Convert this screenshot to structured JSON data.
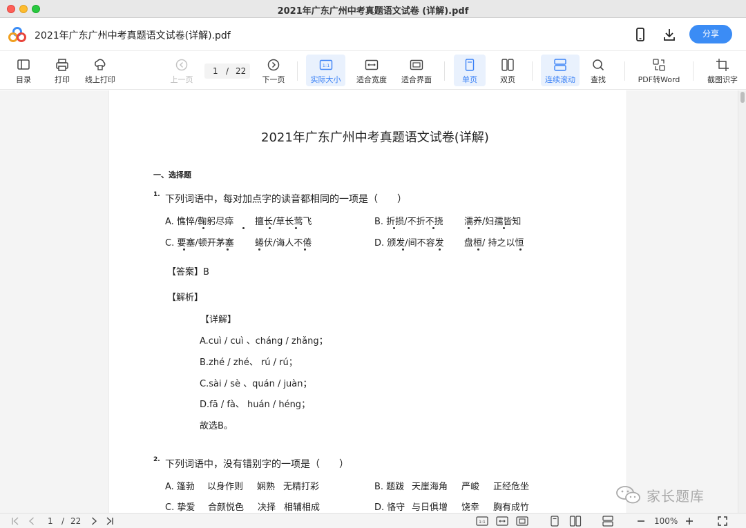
{
  "window": {
    "title": "2021年广东广州中考真题语文试卷 (详解).pdf"
  },
  "header": {
    "doc_title": "2021年广东广州中考真题语文试卷(详解).pdf",
    "share_label": "分享"
  },
  "toolbar": {
    "toc": "目录",
    "print": "打印",
    "online_print": "线上打印",
    "prev_page": "上一页",
    "current_page": "1",
    "page_sep": "/",
    "total_pages": "22",
    "next_page": "下一页",
    "actual_size": "实际大小",
    "fit_width": "适合宽度",
    "fit_page": "适合界面",
    "single_page": "单页",
    "double_page": "双页",
    "continuous_scroll": "连续滚动",
    "find": "查找",
    "pdf_to_word": "PDF转Word",
    "ocr": "截图识字",
    "actual_size_icon_text": "1:1"
  },
  "page": {
    "title": "2021年广东广州中考真题语文试卷(详解)",
    "section": "一、选择题",
    "q1": {
      "num": "1.",
      "stem": "下列词语中，每对加点字的读音都相同的一项是（　　）",
      "a1": "A. 憔悴/鞠躬尽瘁",
      "a2": "擅长/草长莺飞",
      "b1": "B. 折损/不折不挠",
      "b2": "濡养/妇孺皆知",
      "c1": "C. 要塞/顿开茅塞",
      "c2": "蜷伏/诲人不倦",
      "d1": "D. 颁发/间不容发",
      "d2": "盘桓/ 持之以恒",
      "answer": "【答案】B",
      "analysis": "【解析】",
      "detail": "【详解】",
      "l1": "A.cuì / cuì 、cháng / zhǎng；",
      "l2": "B.zhé / zhé、 rú / rú；",
      "l3": "C.sài / sè 、quán / juàn；",
      "l4": "D.fā / fà、 huán / héng；",
      "l5": "故选B。"
    },
    "q2": {
      "num": "2.",
      "stem": "下列词语中，没有错别字的一项是（　　）",
      "a": [
        "A. 篷勃",
        "以身作则",
        "娴熟",
        "无精打彩"
      ],
      "b": [
        "B. 题跋",
        "天崖海角",
        "严峻",
        "正经危坐"
      ],
      "c": [
        "C. 挚爱",
        "合颜悦色",
        "决择",
        "相辅相成"
      ],
      "d": [
        "D. 恪守",
        "与日俱增",
        "饶幸",
        "胸有成竹"
      ]
    }
  },
  "watermark": {
    "text": "家长题库"
  },
  "statusbar": {
    "current_page": "1",
    "page_sep": "/",
    "total_pages": "22",
    "zoom": "100%",
    "actual_size_icon_text": "1:1"
  },
  "colors": {
    "accent": "#3b8cf5",
    "active_bg": "#e9f1fd",
    "active_text": "#3b82f6"
  }
}
